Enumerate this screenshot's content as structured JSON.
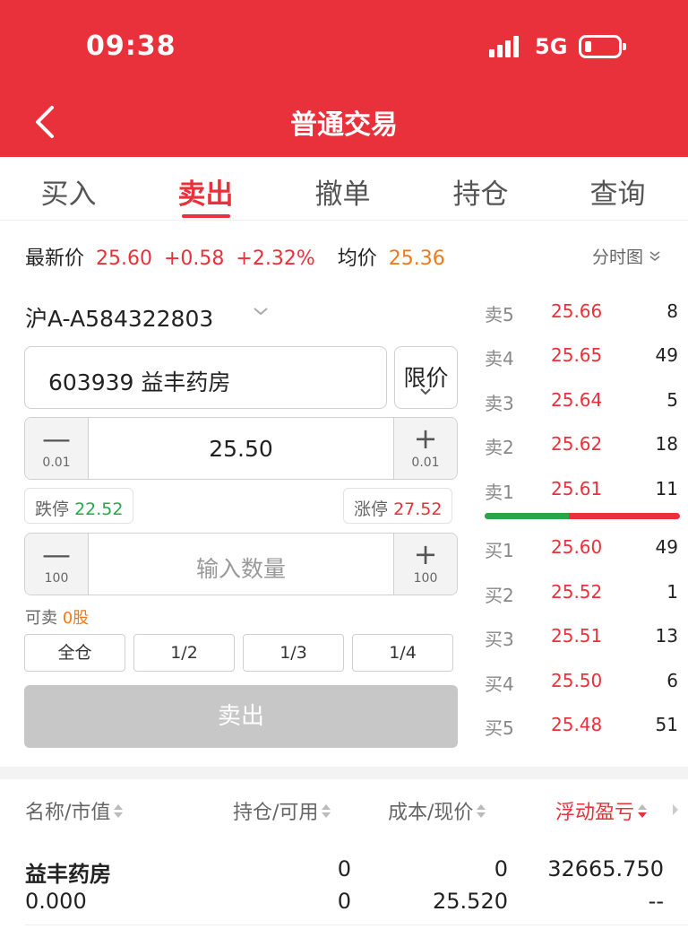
{
  "status_bar": {
    "time": "09:38",
    "network": "5G"
  },
  "header": {
    "title": "普通交易"
  },
  "tabs": [
    {
      "label": "买入",
      "active": false
    },
    {
      "label": "卖出",
      "active": true
    },
    {
      "label": "撤单",
      "active": false
    },
    {
      "label": "持仓",
      "active": false
    },
    {
      "label": "查询",
      "active": false
    }
  ],
  "quote": {
    "latest_label": "最新价",
    "latest_price": "25.60",
    "change": "+0.58",
    "change_pct": "+2.32%",
    "avg_label": "均价",
    "avg_price": "25.36",
    "chart_link": "分时图"
  },
  "form": {
    "account": "沪A-A584322803",
    "stock": "603939 益丰药房",
    "order_type": "限价",
    "price": {
      "value": "25.50",
      "minus_symbol": "—",
      "plus_symbol": "+",
      "step": "0.01"
    },
    "limit_down": {
      "label": "跌停",
      "value": "22.52"
    },
    "limit_up": {
      "label": "涨停",
      "value": "27.52"
    },
    "quantity": {
      "placeholder": "输入数量",
      "minus_symbol": "—",
      "plus_symbol": "+",
      "step": "100"
    },
    "sellable": {
      "label": "可卖",
      "value": "0股"
    },
    "ratio_buttons": [
      "全仓",
      "1/2",
      "1/3",
      "1/4"
    ],
    "submit_label": "卖出"
  },
  "order_book": {
    "asks": [
      {
        "level": "卖5",
        "price": "25.66",
        "volume": "8"
      },
      {
        "level": "卖4",
        "price": "25.65",
        "volume": "49"
      },
      {
        "level": "卖3",
        "price": "25.64",
        "volume": "5"
      },
      {
        "level": "卖2",
        "price": "25.62",
        "volume": "18"
      },
      {
        "level": "卖1",
        "price": "25.61",
        "volume": "11"
      }
    ],
    "buy_sell_ratio": 0.43,
    "bids": [
      {
        "level": "买1",
        "price": "25.60",
        "volume": "49"
      },
      {
        "level": "买2",
        "price": "25.52",
        "volume": "1"
      },
      {
        "level": "买3",
        "price": "25.51",
        "volume": "13"
      },
      {
        "level": "买4",
        "price": "25.50",
        "volume": "6"
      },
      {
        "level": "买5",
        "price": "25.48",
        "volume": "51"
      }
    ]
  },
  "positions": {
    "headers": [
      "名称/市值",
      "持仓/可用",
      "成本/现价",
      "浮动盈亏"
    ],
    "rows": [
      {
        "name": "益丰药房",
        "market_value": "0.000",
        "holding": "0",
        "available": "0",
        "cost": "0",
        "current": "25.520",
        "pnl": "32665.750",
        "pnl_pct": "--"
      }
    ]
  },
  "colors": {
    "brand_red": "#e8313a",
    "up_red": "#e8313a",
    "down_green": "#2aa64a",
    "accent_orange": "#f07a1a"
  }
}
